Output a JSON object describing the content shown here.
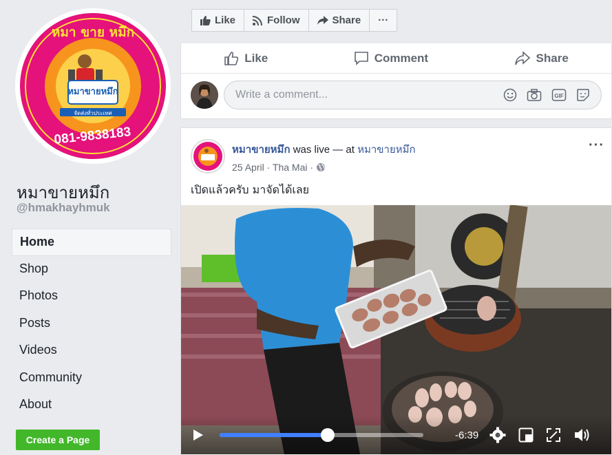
{
  "sidebar": {
    "page_name": "หมาขายหมึก",
    "page_handle": "@hmakhayhmuk",
    "logo": {
      "top_text": "หมา ขาย หมึก",
      "center_text": "หมาขายหมึก",
      "phone": "081-9838183",
      "ribbon": "จัดส่งทั่วประเทศ"
    },
    "nav": [
      {
        "label": "Home",
        "active": true
      },
      {
        "label": "Shop"
      },
      {
        "label": "Photos"
      },
      {
        "label": "Posts"
      },
      {
        "label": "Videos"
      },
      {
        "label": "Community"
      },
      {
        "label": "About"
      }
    ],
    "create_button": "Create a Page"
  },
  "top_actions": {
    "like": "Like",
    "follow": "Follow",
    "share": "Share",
    "more": "···"
  },
  "prev_post": {
    "like": "Like",
    "comment": "Comment",
    "share": "Share",
    "comment_placeholder": "Write a comment..."
  },
  "post": {
    "author": "หมาขายหมึก",
    "action": " was live — at ",
    "location": "หมาขายหมึก",
    "date": "25 April",
    "separator": " · ",
    "place": "Tha Mai",
    "dot": " · ",
    "text": "เปิดแล้วครับ มาจัดได้เลย",
    "more": "···"
  },
  "video": {
    "progress": 0.53,
    "time": "-6:39"
  },
  "colors": {
    "accent": "#4267b2",
    "link": "#385898",
    "create": "#42b72a",
    "progress": "#4080ff",
    "logo_ring": "#e4127a",
    "logo_inner": "#f7941d"
  }
}
